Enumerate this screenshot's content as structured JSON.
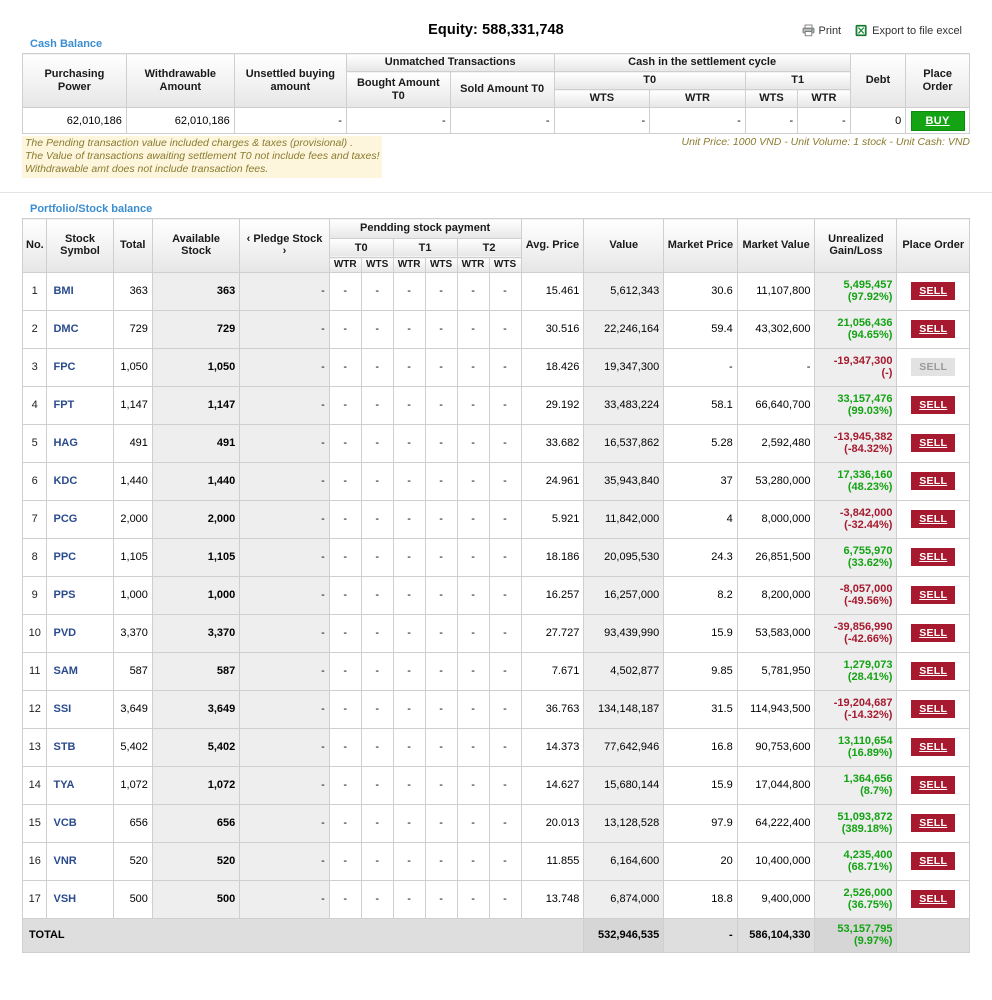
{
  "header": {
    "equity_label": "Equity: 588,331,748",
    "print_label": "Print",
    "export_label": "Export to file excel"
  },
  "cash_section": {
    "title": "Cash Balance",
    "headers": {
      "purchasing_power": "Purchasing Power",
      "withdrawable_amount": "Withdrawable Amount",
      "unsettled_buying_amount": "Unsettled buying amount",
      "unmatched_transactions": "Unmatched Transactions",
      "bought_amount_t0": "Bought Amount T0",
      "sold_amount_t0": "Sold Amount T0",
      "cash_in_settlement_cycle": "Cash in the settlement cycle",
      "t0": "T0",
      "t1": "T1",
      "wts": "WTS",
      "wtr": "WTR",
      "debt": "Debt",
      "place_order": "Place Order"
    },
    "row": {
      "purchasing_power": "62,010,186",
      "withdrawable_amount": "62,010,186",
      "unsettled_buying_amount": "-",
      "bought_amount_t0": "-",
      "sold_amount_t0": "-",
      "t0_wts": "-",
      "t0_wtr": "-",
      "t1_wts": "-",
      "t1_wtr": "-",
      "debt": "0",
      "buy_label": "BUY"
    },
    "notes": {
      "line1": "The Pending transaction value included charges & taxes (provisional) .",
      "line2": "The Value of transactions awaiting settlement T0 not include fees and taxes!",
      "line3": "Withdrawable amt does not include transaction fees.",
      "units": "Unit Price: 1000 VND - Unit Volume: 1 stock - Unit Cash: VND"
    }
  },
  "portfolio_section": {
    "title": "Portfolio/Stock balance",
    "headers": {
      "no": "No.",
      "stock_symbol": "Stock Symbol",
      "total": "Total",
      "available_stock": "Available Stock",
      "pledge_stock": "‹  Pledge Stock  ›",
      "pending_stock_payment": "Pendding stock payment",
      "t0": "T0",
      "t1": "T1",
      "t2": "T2",
      "wtr": "WTR",
      "wts": "WTS",
      "avg_price": "Avg. Price",
      "value": "Value",
      "market_price": "Market Price",
      "market_value": "Market Value",
      "unrealized_gain_loss_1": "Unrealized",
      "unrealized_gain_loss_2": "Gain/Loss",
      "place_order": "Place Order"
    },
    "sell_label": "SELL",
    "rows": [
      {
        "no": "1",
        "symbol": "BMI",
        "total": "363",
        "available": "363",
        "pledge": "-",
        "t0_wtr": "-",
        "t0_wts": "-",
        "t1_wtr": "-",
        "t1_wts": "-",
        "t2_wtr": "-",
        "t2_wts": "-",
        "avg_price": "15.461",
        "value": "5,612,343",
        "market_price": "30.6",
        "market_value": "11,107,800",
        "gl_amount": "5,495,457",
        "gl_percent": "(97.92%)",
        "gl_sign": "gain",
        "sell_enabled": true
      },
      {
        "no": "2",
        "symbol": "DMC",
        "total": "729",
        "available": "729",
        "pledge": "-",
        "t0_wtr": "-",
        "t0_wts": "-",
        "t1_wtr": "-",
        "t1_wts": "-",
        "t2_wtr": "-",
        "t2_wts": "-",
        "avg_price": "30.516",
        "value": "22,246,164",
        "market_price": "59.4",
        "market_value": "43,302,600",
        "gl_amount": "21,056,436",
        "gl_percent": "(94.65%)",
        "gl_sign": "gain",
        "sell_enabled": true
      },
      {
        "no": "3",
        "symbol": "FPC",
        "total": "1,050",
        "available": "1,050",
        "pledge": "-",
        "t0_wtr": "-",
        "t0_wts": "-",
        "t1_wtr": "-",
        "t1_wts": "-",
        "t2_wtr": "-",
        "t2_wts": "-",
        "avg_price": "18.426",
        "value": "19,347,300",
        "market_price": "-",
        "market_value": "-",
        "gl_amount": "-19,347,300",
        "gl_percent": "(-)",
        "gl_sign": "loss",
        "sell_enabled": false
      },
      {
        "no": "4",
        "symbol": "FPT",
        "total": "1,147",
        "available": "1,147",
        "pledge": "-",
        "t0_wtr": "-",
        "t0_wts": "-",
        "t1_wtr": "-",
        "t1_wts": "-",
        "t2_wtr": "-",
        "t2_wts": "-",
        "avg_price": "29.192",
        "value": "33,483,224",
        "market_price": "58.1",
        "market_value": "66,640,700",
        "gl_amount": "33,157,476",
        "gl_percent": "(99.03%)",
        "gl_sign": "gain",
        "sell_enabled": true
      },
      {
        "no": "5",
        "symbol": "HAG",
        "total": "491",
        "available": "491",
        "pledge": "-",
        "t0_wtr": "-",
        "t0_wts": "-",
        "t1_wtr": "-",
        "t1_wts": "-",
        "t2_wtr": "-",
        "t2_wts": "-",
        "avg_price": "33.682",
        "value": "16,537,862",
        "market_price": "5.28",
        "market_value": "2,592,480",
        "gl_amount": "-13,945,382",
        "gl_percent": "(-84.32%)",
        "gl_sign": "loss",
        "sell_enabled": true
      },
      {
        "no": "6",
        "symbol": "KDC",
        "total": "1,440",
        "available": "1,440",
        "pledge": "-",
        "t0_wtr": "-",
        "t0_wts": "-",
        "t1_wtr": "-",
        "t1_wts": "-",
        "t2_wtr": "-",
        "t2_wts": "-",
        "avg_price": "24.961",
        "value": "35,943,840",
        "market_price": "37",
        "market_value": "53,280,000",
        "gl_amount": "17,336,160",
        "gl_percent": "(48.23%)",
        "gl_sign": "gain",
        "sell_enabled": true
      },
      {
        "no": "7",
        "symbol": "PCG",
        "total": "2,000",
        "available": "2,000",
        "pledge": "-",
        "t0_wtr": "-",
        "t0_wts": "-",
        "t1_wtr": "-",
        "t1_wts": "-",
        "t2_wtr": "-",
        "t2_wts": "-",
        "avg_price": "5.921",
        "value": "11,842,000",
        "market_price": "4",
        "market_value": "8,000,000",
        "gl_amount": "-3,842,000",
        "gl_percent": "(-32.44%)",
        "gl_sign": "loss",
        "sell_enabled": true
      },
      {
        "no": "8",
        "symbol": "PPC",
        "total": "1,105",
        "available": "1,105",
        "pledge": "-",
        "t0_wtr": "-",
        "t0_wts": "-",
        "t1_wtr": "-",
        "t1_wts": "-",
        "t2_wtr": "-",
        "t2_wts": "-",
        "avg_price": "18.186",
        "value": "20,095,530",
        "market_price": "24.3",
        "market_value": "26,851,500",
        "gl_amount": "6,755,970",
        "gl_percent": "(33.62%)",
        "gl_sign": "gain",
        "sell_enabled": true
      },
      {
        "no": "9",
        "symbol": "PPS",
        "total": "1,000",
        "available": "1,000",
        "pledge": "-",
        "t0_wtr": "-",
        "t0_wts": "-",
        "t1_wtr": "-",
        "t1_wts": "-",
        "t2_wtr": "-",
        "t2_wts": "-",
        "avg_price": "16.257",
        "value": "16,257,000",
        "market_price": "8.2",
        "market_value": "8,200,000",
        "gl_amount": "-8,057,000",
        "gl_percent": "(-49.56%)",
        "gl_sign": "loss",
        "sell_enabled": true
      },
      {
        "no": "10",
        "symbol": "PVD",
        "total": "3,370",
        "available": "3,370",
        "pledge": "-",
        "t0_wtr": "-",
        "t0_wts": "-",
        "t1_wtr": "-",
        "t1_wts": "-",
        "t2_wtr": "-",
        "t2_wts": "-",
        "avg_price": "27.727",
        "value": "93,439,990",
        "market_price": "15.9",
        "market_value": "53,583,000",
        "gl_amount": "-39,856,990",
        "gl_percent": "(-42.66%)",
        "gl_sign": "loss",
        "sell_enabled": true
      },
      {
        "no": "11",
        "symbol": "SAM",
        "total": "587",
        "available": "587",
        "pledge": "-",
        "t0_wtr": "-",
        "t0_wts": "-",
        "t1_wtr": "-",
        "t1_wts": "-",
        "t2_wtr": "-",
        "t2_wts": "-",
        "avg_price": "7.671",
        "value": "4,502,877",
        "market_price": "9.85",
        "market_value": "5,781,950",
        "gl_amount": "1,279,073",
        "gl_percent": "(28.41%)",
        "gl_sign": "gain",
        "sell_enabled": true
      },
      {
        "no": "12",
        "symbol": "SSI",
        "total": "3,649",
        "available": "3,649",
        "pledge": "-",
        "t0_wtr": "-",
        "t0_wts": "-",
        "t1_wtr": "-",
        "t1_wts": "-",
        "t2_wtr": "-",
        "t2_wts": "-",
        "avg_price": "36.763",
        "value": "134,148,187",
        "market_price": "31.5",
        "market_value": "114,943,500",
        "gl_amount": "-19,204,687",
        "gl_percent": "(-14.32%)",
        "gl_sign": "loss",
        "sell_enabled": true
      },
      {
        "no": "13",
        "symbol": "STB",
        "total": "5,402",
        "available": "5,402",
        "pledge": "-",
        "t0_wtr": "-",
        "t0_wts": "-",
        "t1_wtr": "-",
        "t1_wts": "-",
        "t2_wtr": "-",
        "t2_wts": "-",
        "avg_price": "14.373",
        "value": "77,642,946",
        "market_price": "16.8",
        "market_value": "90,753,600",
        "gl_amount": "13,110,654",
        "gl_percent": "(16.89%)",
        "gl_sign": "gain",
        "sell_enabled": true
      },
      {
        "no": "14",
        "symbol": "TYA",
        "total": "1,072",
        "available": "1,072",
        "pledge": "-",
        "t0_wtr": "-",
        "t0_wts": "-",
        "t1_wtr": "-",
        "t1_wts": "-",
        "t2_wtr": "-",
        "t2_wts": "-",
        "avg_price": "14.627",
        "value": "15,680,144",
        "market_price": "15.9",
        "market_value": "17,044,800",
        "gl_amount": "1,364,656",
        "gl_percent": "(8.7%)",
        "gl_sign": "gain",
        "sell_enabled": true
      },
      {
        "no": "15",
        "symbol": "VCB",
        "total": "656",
        "available": "656",
        "pledge": "-",
        "t0_wtr": "-",
        "t0_wts": "-",
        "t1_wtr": "-",
        "t1_wts": "-",
        "t2_wtr": "-",
        "t2_wts": "-",
        "avg_price": "20.013",
        "value": "13,128,528",
        "market_price": "97.9",
        "market_value": "64,222,400",
        "gl_amount": "51,093,872",
        "gl_percent": "(389.18%)",
        "gl_sign": "gain",
        "sell_enabled": true
      },
      {
        "no": "16",
        "symbol": "VNR",
        "total": "520",
        "available": "520",
        "pledge": "-",
        "t0_wtr": "-",
        "t0_wts": "-",
        "t1_wtr": "-",
        "t1_wts": "-",
        "t2_wtr": "-",
        "t2_wts": "-",
        "avg_price": "11.855",
        "value": "6,164,600",
        "market_price": "20",
        "market_value": "10,400,000",
        "gl_amount": "4,235,400",
        "gl_percent": "(68.71%)",
        "gl_sign": "gain",
        "sell_enabled": true
      },
      {
        "no": "17",
        "symbol": "VSH",
        "total": "500",
        "available": "500",
        "pledge": "-",
        "t0_wtr": "-",
        "t0_wts": "-",
        "t1_wtr": "-",
        "t1_wts": "-",
        "t2_wtr": "-",
        "t2_wts": "-",
        "avg_price": "13.748",
        "value": "6,874,000",
        "market_price": "18.8",
        "market_value": "9,400,000",
        "gl_amount": "2,526,000",
        "gl_percent": "(36.75%)",
        "gl_sign": "gain",
        "sell_enabled": true
      }
    ],
    "total_row": {
      "label": "TOTAL",
      "value": "532,946,535",
      "market_price": "-",
      "market_value": "586,104,330",
      "gl_amount": "53,157,795",
      "gl_percent": "(9.97%)",
      "gl_sign": "gain"
    }
  },
  "colors": {
    "link_blue": "#3b8dd0",
    "symbol_blue": "#2a4b8d",
    "gain_green": "#13a313",
    "loss_red": "#a6192e",
    "buy_green": "#13a313",
    "sell_red": "#a6192e",
    "note_yellow_bg": "#fdf6dd"
  }
}
